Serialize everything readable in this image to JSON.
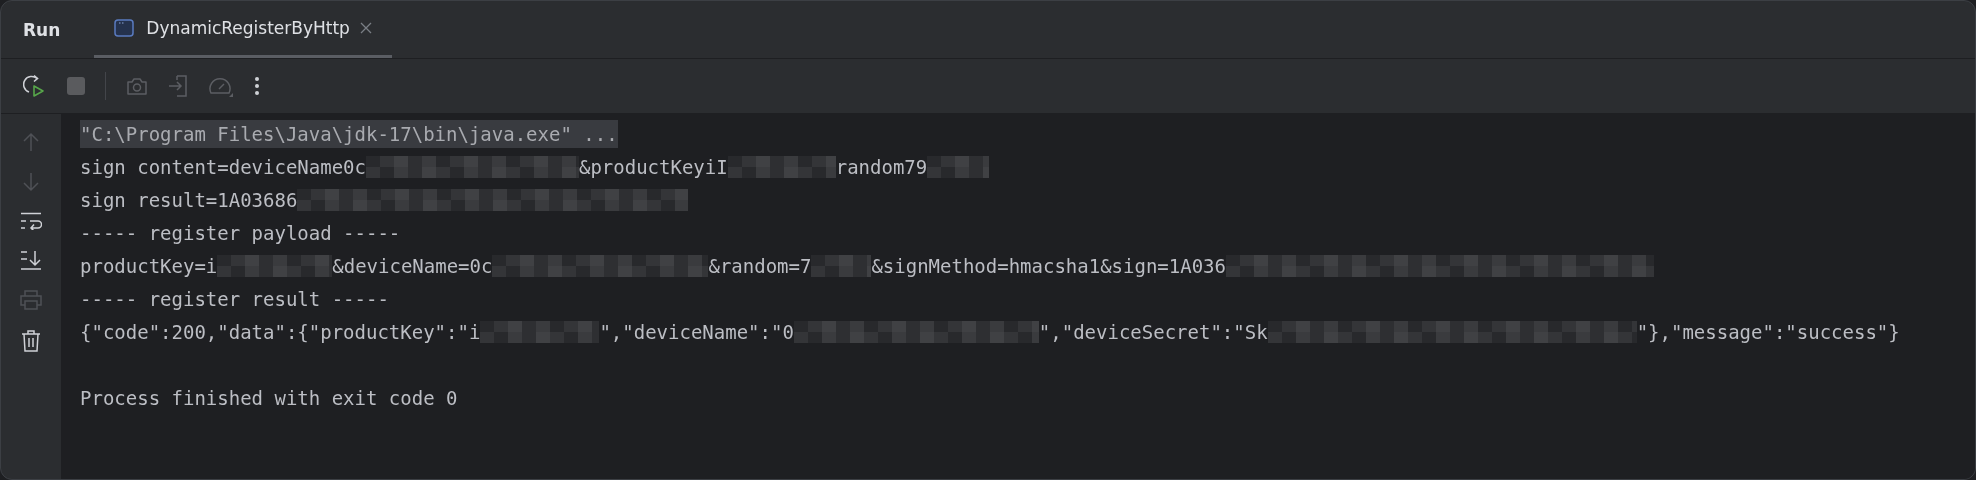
{
  "tool_window": {
    "title": "Run"
  },
  "tabs": [
    {
      "label": "DynamicRegisterByHttp",
      "selected": true
    }
  ],
  "console": {
    "lines": [
      {
        "kind": "command",
        "segments": [
          {
            "kind": "text",
            "text": "\"C:\\Program Files\\Java\\jdk-17\\bin\\java.exe\" ..."
          }
        ]
      },
      {
        "kind": "output",
        "segments": [
          {
            "kind": "text",
            "text": "sign content=deviceName0c"
          },
          {
            "kind": "mask"
          },
          {
            "kind": "text",
            "text": "&productKeyiI"
          },
          {
            "kind": "mask"
          },
          {
            "kind": "text",
            "text": "random79"
          },
          {
            "kind": "mask"
          }
        ]
      },
      {
        "kind": "output",
        "segments": [
          {
            "kind": "text",
            "text": "sign result=1A03686"
          },
          {
            "kind": "mask"
          }
        ]
      },
      {
        "kind": "output",
        "segments": [
          {
            "kind": "text",
            "text": "----- register payload -----"
          }
        ]
      },
      {
        "kind": "output",
        "segments": [
          {
            "kind": "text",
            "text": "productKey=i"
          },
          {
            "kind": "mask"
          },
          {
            "kind": "text",
            "text": "&deviceName=0c"
          },
          {
            "kind": "mask"
          },
          {
            "kind": "text",
            "text": "&random=7"
          },
          {
            "kind": "mask"
          },
          {
            "kind": "text",
            "text": "&signMethod=hmacsha1&sign=1A036"
          },
          {
            "kind": "mask"
          }
        ]
      },
      {
        "kind": "output",
        "segments": [
          {
            "kind": "text",
            "text": "----- register result -----"
          }
        ]
      },
      {
        "kind": "output",
        "segments": [
          {
            "kind": "text",
            "text": "{\"code\":200,\"data\":{\"productKey\":\"i"
          },
          {
            "kind": "mask"
          },
          {
            "kind": "text",
            "text": "\",\"deviceName\":\"0"
          },
          {
            "kind": "mask"
          },
          {
            "kind": "text",
            "text": "\",\"deviceSecret\":\"Sk"
          },
          {
            "kind": "mask"
          },
          {
            "kind": "text",
            "text": "\"},\"message\":\"success\"}"
          }
        ]
      },
      {
        "kind": "blank"
      },
      {
        "kind": "output",
        "segments": [
          {
            "kind": "text",
            "text": "Process finished with exit code 0"
          }
        ]
      }
    ]
  }
}
